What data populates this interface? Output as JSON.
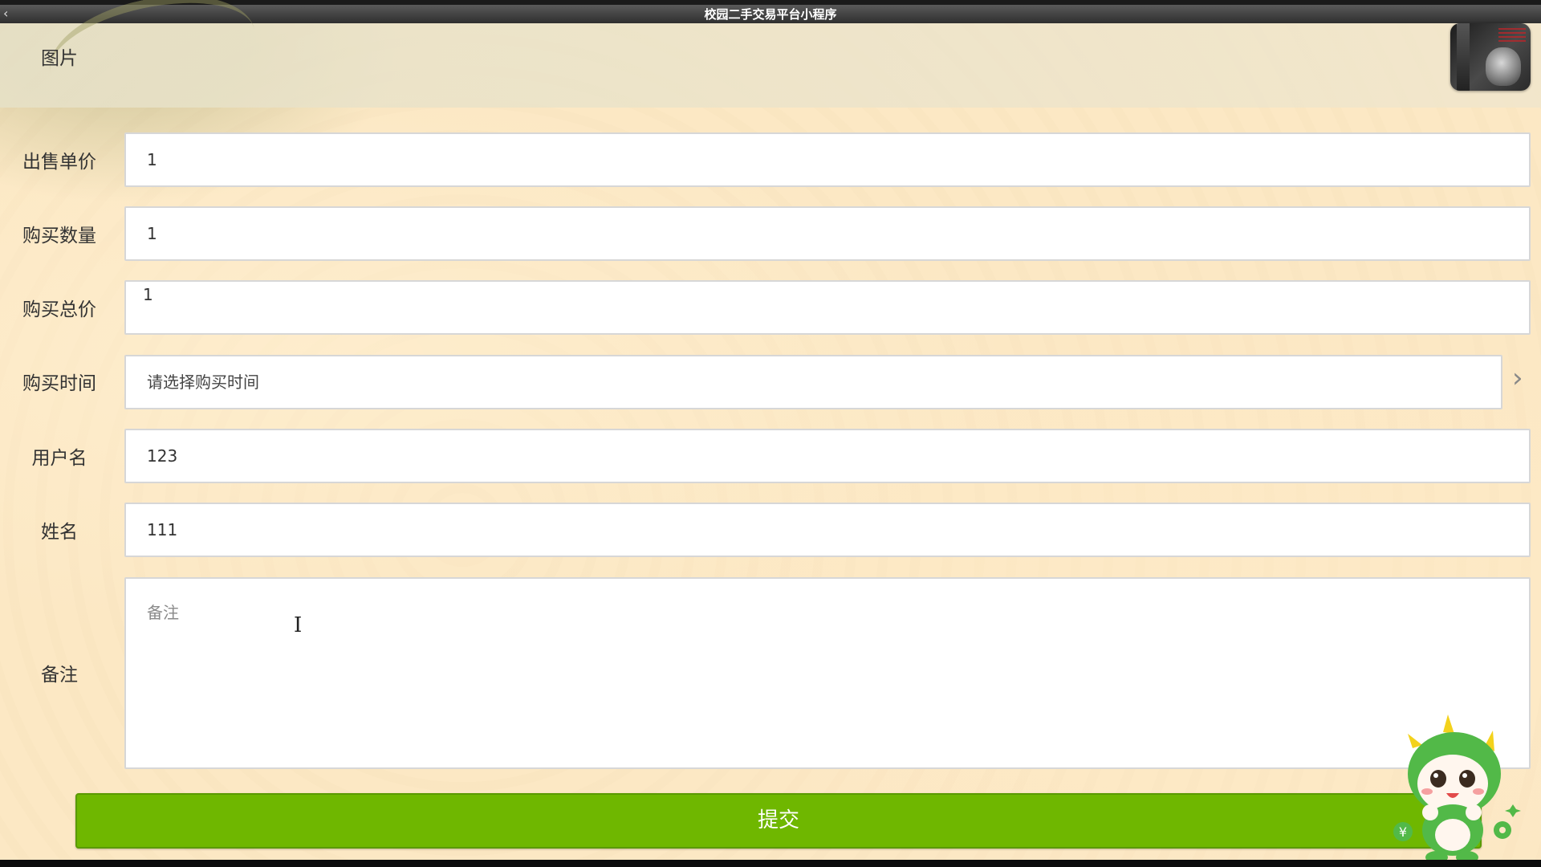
{
  "window": {
    "title": "校园二手交易平台小程序",
    "back_glyph": "‹"
  },
  "image_row": {
    "label": "图片"
  },
  "form": {
    "fields": [
      {
        "label": "出售单价",
        "value": "1"
      },
      {
        "label": "购买数量",
        "value": "1"
      },
      {
        "label": "购买总价",
        "value": "1"
      },
      {
        "label": "购买时间",
        "placeholder": "请选择购买时间",
        "chevron": "›"
      },
      {
        "label": "用户名",
        "value": "123"
      },
      {
        "label": "姓名",
        "value": "111"
      }
    ],
    "remarks": {
      "label": "备注",
      "placeholder": "备注"
    },
    "submit_label": "提交"
  },
  "icons": {
    "thumbnail": "book-cover-image",
    "mascot": "dinosaur-cat-mascot-sticker",
    "cursor": "text-cursor-icon"
  },
  "colors": {
    "submit_bg": "#6fb700",
    "page_bg": "#fce8c4",
    "titlebar_bg": "#3a3a3a"
  }
}
